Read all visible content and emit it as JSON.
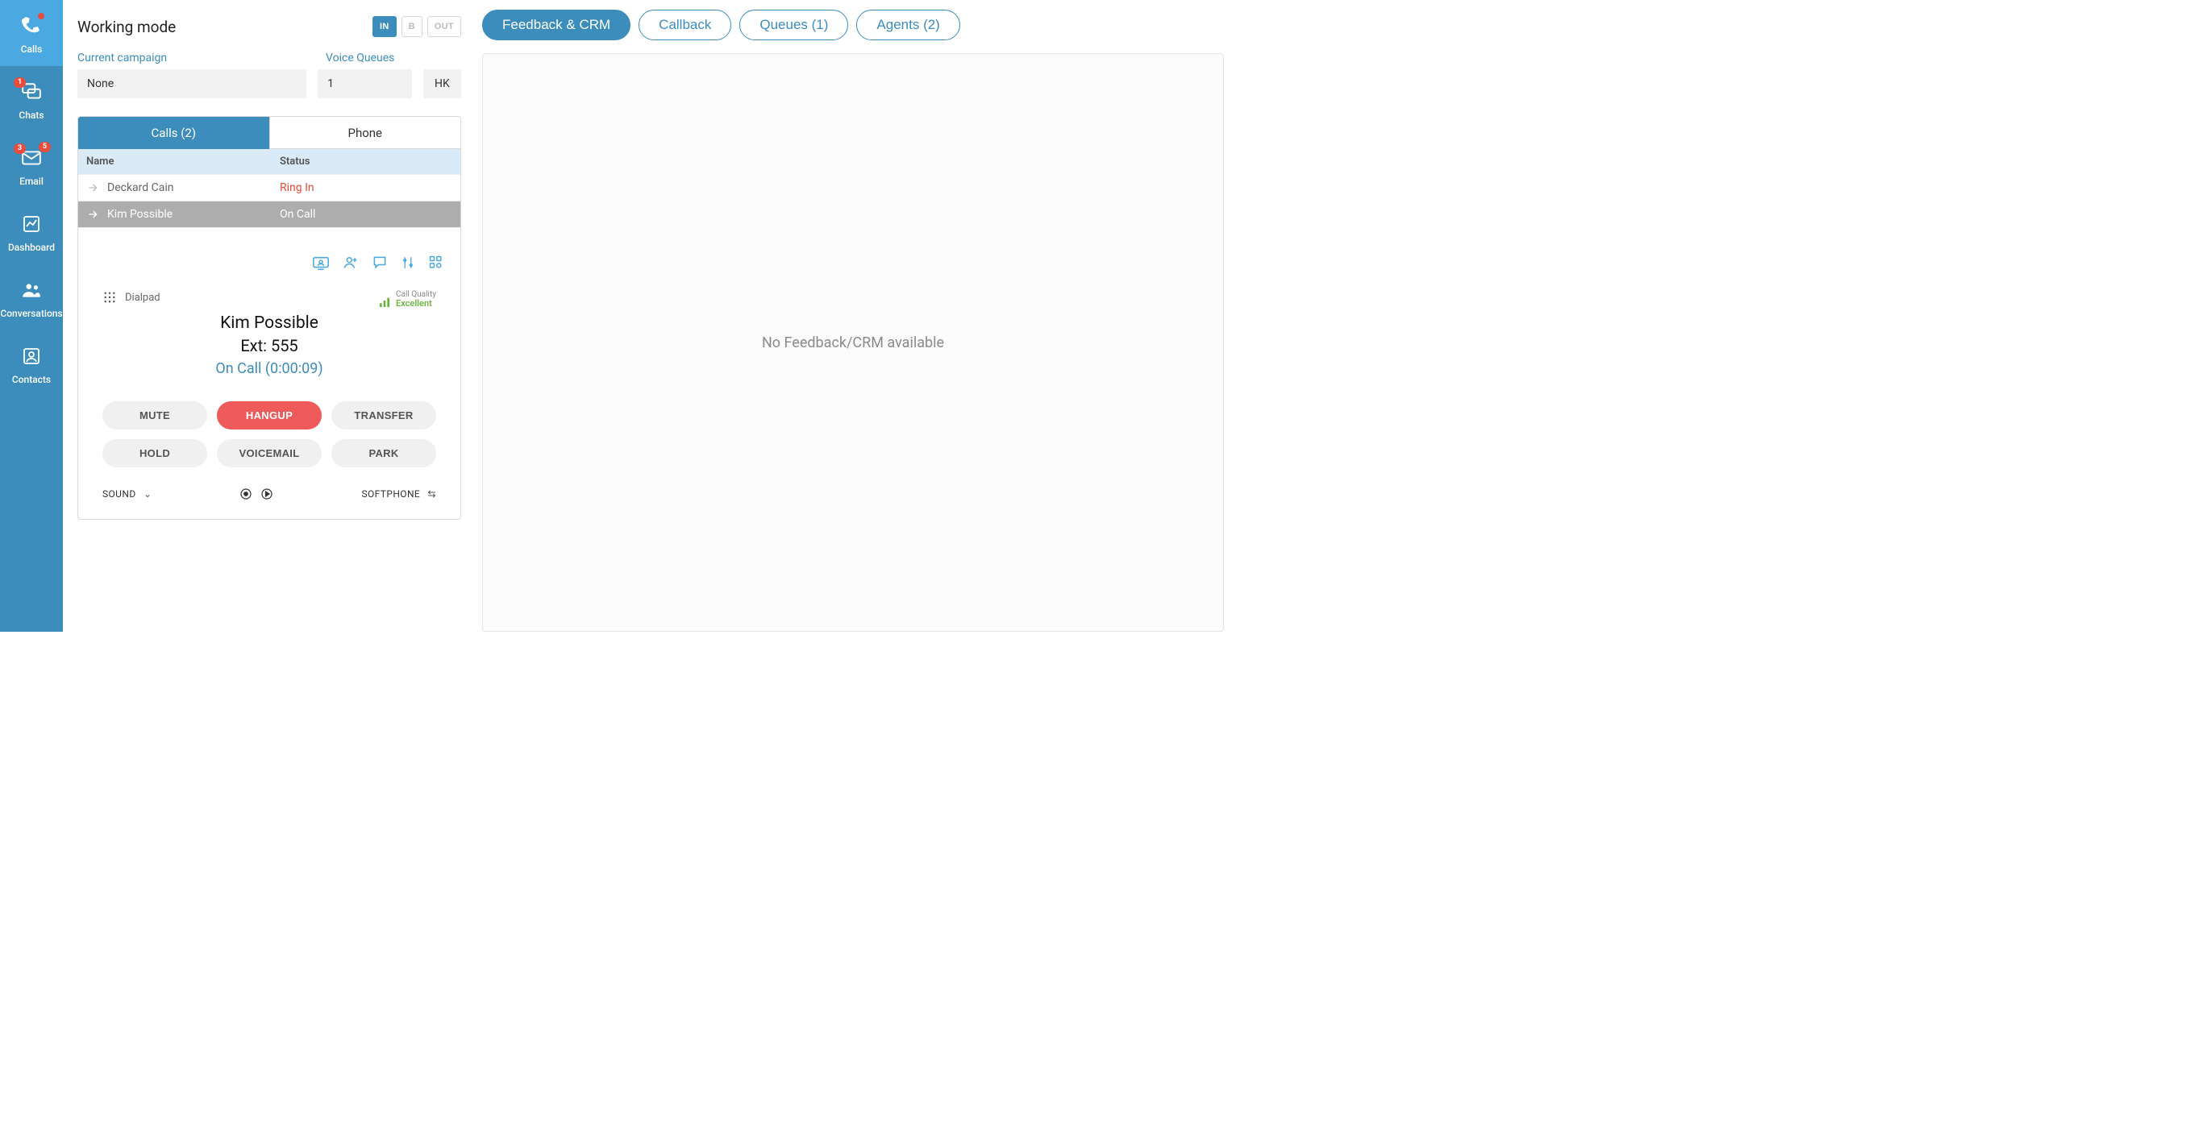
{
  "sidebar": {
    "items": [
      {
        "label": "Calls",
        "active": true,
        "icon": "phone"
      },
      {
        "label": "Chats",
        "icon": "chat",
        "badge1": "1"
      },
      {
        "label": "Email",
        "icon": "mail",
        "badge1": "3",
        "badge2": "5"
      },
      {
        "label": "Dashboard",
        "icon": "dashboard"
      },
      {
        "label": "Conversations",
        "icon": "group"
      },
      {
        "label": "Contacts",
        "icon": "contact"
      }
    ]
  },
  "workingMode": {
    "title": "Working mode",
    "buttons": {
      "in": "IN",
      "b": "B",
      "out": "OUT"
    },
    "campaignLabel": "Current campaign",
    "campaignValue": "None",
    "queuesLabel": "Voice Queues",
    "queuesValue": "1",
    "hkValue": "HK"
  },
  "callsCard": {
    "tabs": {
      "calls": "Calls (2)",
      "phone": "Phone"
    },
    "headers": {
      "name": "Name",
      "status": "Status"
    },
    "rows": [
      {
        "name": "Deckard Cain",
        "status": "Ring In",
        "selected": false,
        "statusClass": "ringin"
      },
      {
        "name": "Kim Possible",
        "status": "On Call",
        "selected": true,
        "statusClass": "oncall"
      }
    ],
    "dialpadLabel": "Dialpad",
    "quality": {
      "label": "Call Quality",
      "value": "Excellent"
    },
    "callerName": "Kim Possible",
    "callerExt": "Ext: 555",
    "callStatus": "On Call (0:00:09)",
    "buttons": {
      "mute": "MUTE",
      "hangup": "HANGUP",
      "transfer": "TRANSFER",
      "hold": "HOLD",
      "voicemail": "VOICEMAIL",
      "park": "PARK"
    },
    "soundLabel": "SOUND",
    "softphoneLabel": "SOFTPHONE"
  },
  "rightPanel": {
    "tabs": {
      "feedback": "Feedback & CRM",
      "callback": "Callback",
      "queues": "Queues (1)",
      "agents": "Agents (2)"
    },
    "emptyText": "No Feedback/CRM available"
  }
}
